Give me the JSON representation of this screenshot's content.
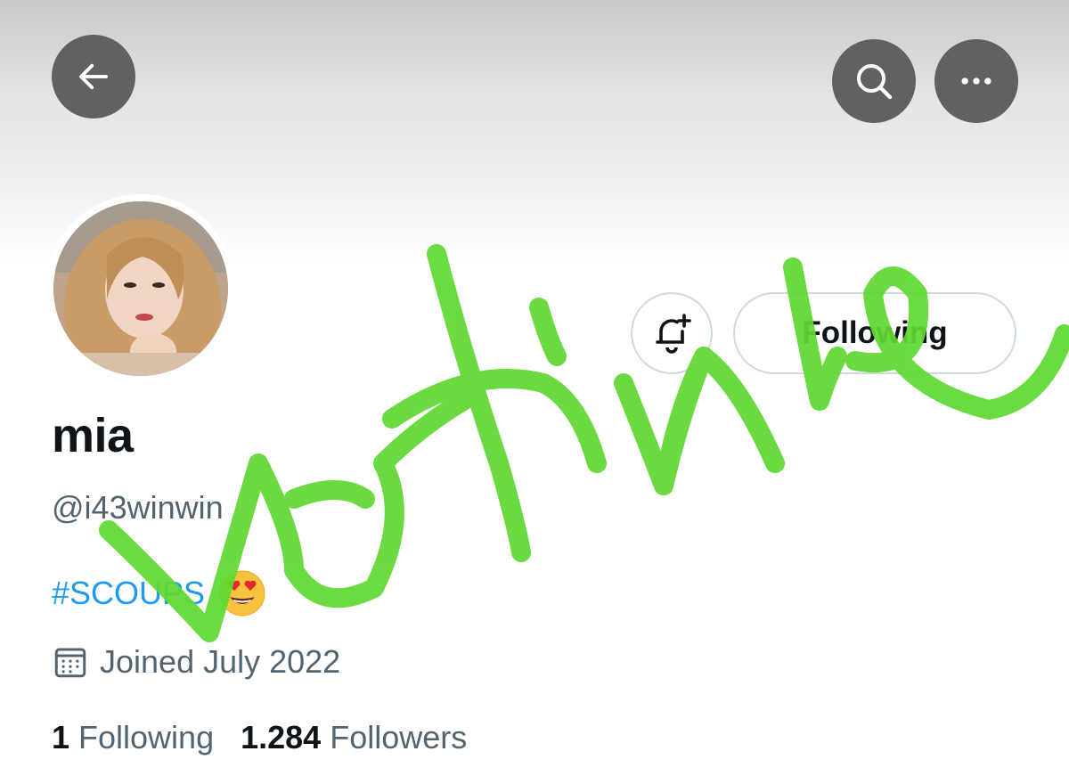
{
  "header": {
    "back_icon": "arrow-left-icon",
    "search_icon": "search-icon",
    "more_icon": "more-horizontal-icon"
  },
  "profile": {
    "name": "mia",
    "handle": "@i43winwin",
    "bio_hashtag": "#SCOUPS",
    "bio_emoji": "smiling-face-with-heart-eyes",
    "joined": "Joined July 2022"
  },
  "actions": {
    "notify_icon": "bell-plus-icon",
    "follow_label": "Following"
  },
  "stats": {
    "following_count": "1",
    "following_label": "Following",
    "followers_count": "1.284",
    "followers_label": "Followers"
  },
  "overlay": {
    "scribble_color": "#5fd832"
  },
  "colors": {
    "link": "#1d9bf0",
    "secondary_text": "#536471",
    "icon_button_bg": "#5f6162"
  }
}
